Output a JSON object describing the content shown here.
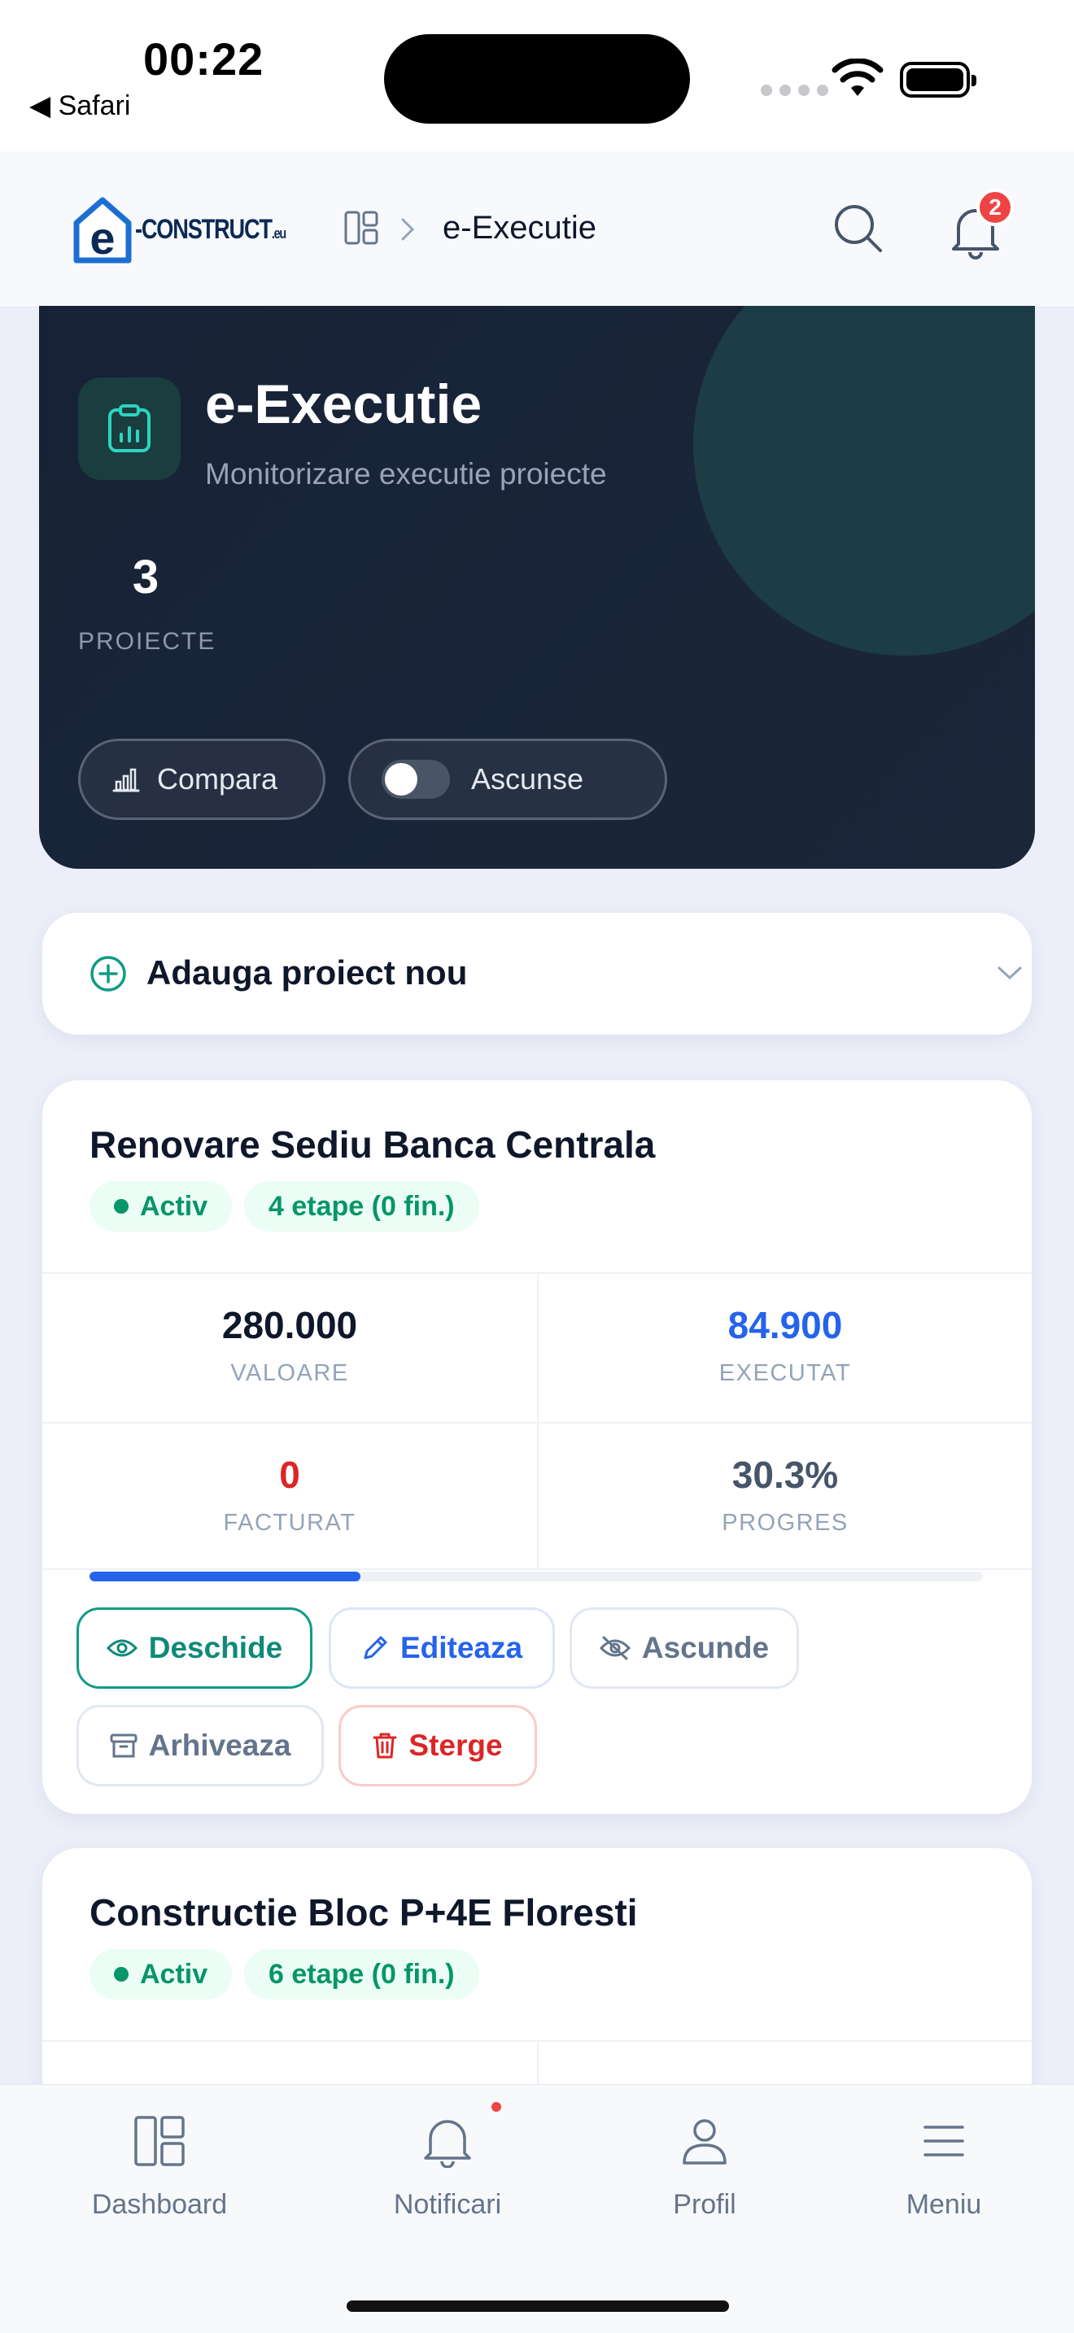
{
  "status_bar": {
    "time": "00:22",
    "back_label": "◀ Safari"
  },
  "header": {
    "logo_text": "-CONSTRUCT",
    "logo_suffix": ".eu",
    "breadcrumb_title": "e-Executie",
    "notification_count": "2"
  },
  "hero": {
    "title": "e-Executie",
    "subtitle": "Monitorizare executie proiecte",
    "project_count": "3",
    "project_count_label": "PROIECTE",
    "compare_label": "Compara",
    "hidden_label": "Ascunse"
  },
  "add_project": {
    "label": "Adauga proiect nou"
  },
  "projects": [
    {
      "title": "Renovare Sediu Banca Centrala",
      "status": "Activ",
      "stages": "4 etape (0 fin.)",
      "value": "280.000",
      "value_label": "VALOARE",
      "executed": "84.900",
      "executed_label": "EXECUTAT",
      "invoiced": "0",
      "invoiced_label": "FACTURAT",
      "progress": "30.3%",
      "progress_fraction": 0.303,
      "progress_label": "PROGRES",
      "actions": {
        "open": "Deschide",
        "edit": "Editeaza",
        "hide": "Ascunde",
        "archive": "Arhiveaza",
        "delete": "Sterge"
      }
    },
    {
      "title": "Constructie Bloc P+4E Floresti",
      "status": "Activ",
      "stages": "6 etape (0 fin.)"
    }
  ],
  "bottom_nav": {
    "dashboard": "Dashboard",
    "notifications": "Notificari",
    "profile": "Profil",
    "menu": "Meniu"
  },
  "colors": {
    "accent_teal": "#0f9b86",
    "accent_blue": "#2563eb",
    "danger_red": "#dc2626",
    "hero_bg": "#172236",
    "badge_red": "#ef4444"
  }
}
